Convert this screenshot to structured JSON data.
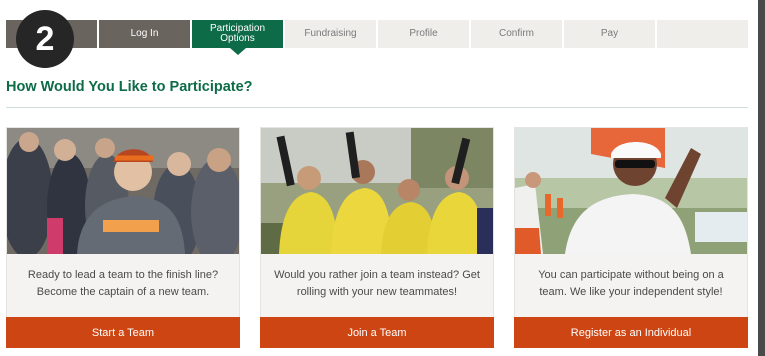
{
  "progress": {
    "current_step_number": "2",
    "steps": [
      {
        "label": "",
        "state": "done"
      },
      {
        "label": "Log In",
        "state": "done"
      },
      {
        "label": "Participation Options",
        "state": "active"
      },
      {
        "label": "Fundraising",
        "state": "upcoming"
      },
      {
        "label": "Profile",
        "state": "upcoming"
      },
      {
        "label": "Confirm",
        "state": "upcoming"
      },
      {
        "label": "Pay",
        "state": "upcoming"
      },
      {
        "label": "",
        "state": "upcoming"
      }
    ]
  },
  "main": {
    "title": "How Would You Like to Participate?"
  },
  "options": [
    {
      "photo": "team-captain-photo",
      "description": "Ready to lead a team to the finish line? Become the captain of a new team.",
      "button_label": "Start a Team"
    },
    {
      "photo": "join-team-photo",
      "description": "Would you rather join a team instead? Get rolling with your new teammates!",
      "button_label": "Join a Team"
    },
    {
      "photo": "individual-participant-photo",
      "description": "You can participate without being on a team. We like your independent style!",
      "button_label": "Register as an Individual"
    }
  ],
  "colors": {
    "brand_green": "#0d6b48",
    "cta_orange": "#cc4512",
    "step_done": "#6a645e",
    "step_upcoming": "#efeeeb",
    "step_badge": "#262626"
  }
}
